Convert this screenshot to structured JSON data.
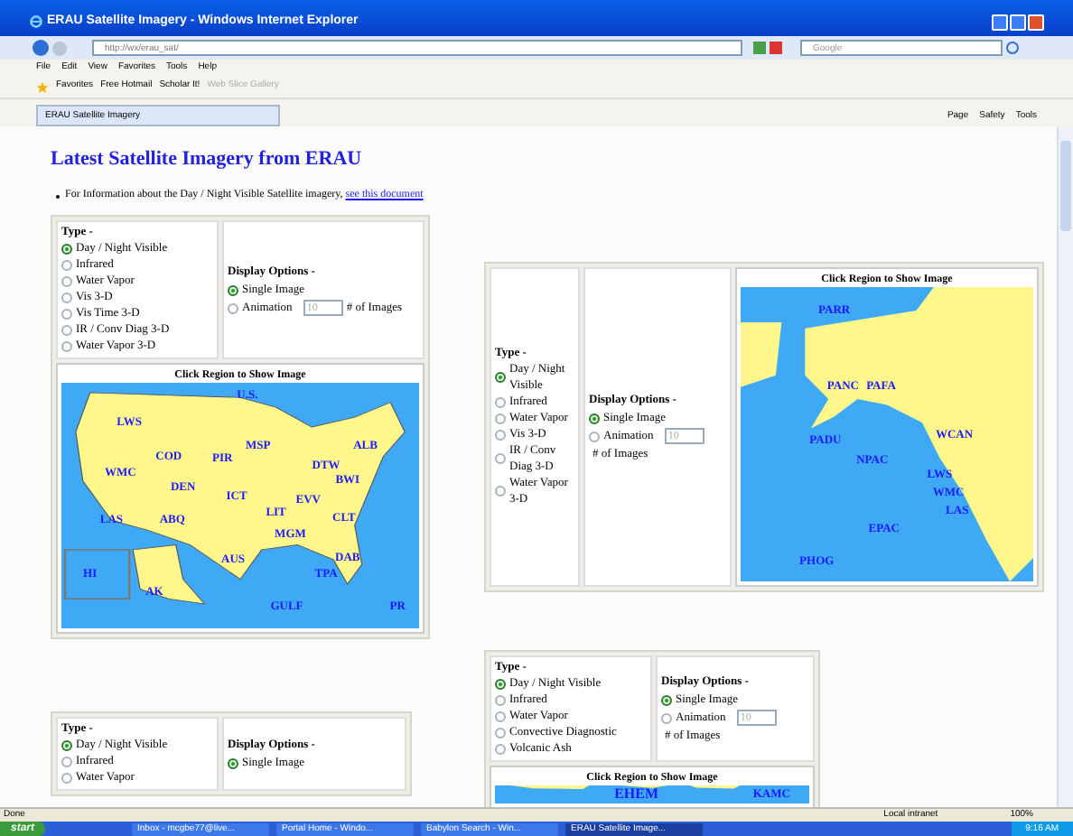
{
  "window": {
    "title": "ERAU Satellite Imagery - Windows Internet Explorer"
  },
  "address_bar": {
    "url": "http://wx/erau_sat/",
    "search_placeholder": "Google"
  },
  "menu": [
    "File",
    "Edit",
    "View",
    "Favorites",
    "Tools",
    "Help"
  ],
  "favorites_bar": {
    "label": "Favorites",
    "links": [
      {
        "label": "Free Hotmail",
        "disabled": false
      },
      {
        "label": "Scholar It!",
        "disabled": false
      },
      {
        "label": "Web Slice Gallery",
        "disabled": true
      }
    ]
  },
  "tabs": [
    {
      "label": "ERAU Satellite Imagery",
      "selected": true
    }
  ],
  "command_bar": [
    "Page",
    "Safety",
    "Tools"
  ],
  "page": {
    "heading": "Latest Satellite Imagery from ERAU",
    "info": {
      "text": "For Information about the Day / Night Visible Satellite imagery,",
      "link": "see this document"
    },
    "panels": [
      {
        "type_label": "Type -",
        "types": [
          {
            "label": "Day / Night Visible",
            "selected": true
          },
          {
            "label": "Infrared",
            "selected": false
          },
          {
            "label": "Water Vapor",
            "selected": false
          },
          {
            "label": "Vis 3-D",
            "selected": false
          },
          {
            "label": "Vis Time 3-D",
            "selected": false
          },
          {
            "label": "IR / Conv Diag 3-D",
            "selected": false
          },
          {
            "label": "Water Vapor 3-D",
            "selected": false
          }
        ],
        "display_label": "Display Options -",
        "display": [
          {
            "label": "Single Image",
            "selected": true
          },
          {
            "label": "Animation",
            "selected": false
          }
        ],
        "frames": {
          "value": "10",
          "label": "# of Images"
        },
        "map": {
          "caption": "Click Region to Show Image",
          "kind": "conus",
          "labels": [
            "U.S.",
            "LWS",
            "COD",
            "PIR",
            "MSP",
            "ALB",
            "DTW",
            "WMC",
            "DEN",
            "ICT",
            "BWI",
            "EVV",
            "LAS",
            "ABQ",
            "LIT",
            "CLT",
            "MGM",
            "AUS",
            "DAB",
            "TPA",
            "HI",
            "AK",
            "GULF",
            "PR"
          ]
        }
      },
      {
        "type_label": "Type -",
        "types": [
          {
            "label": "Day / Night Visible",
            "selected": true
          },
          {
            "label": "Infrared",
            "selected": false
          },
          {
            "label": "Water Vapor",
            "selected": false
          },
          {
            "label": "Vis 3-D",
            "selected": false
          },
          {
            "label": "IR / Conv Diag 3-D",
            "selected": false
          },
          {
            "label": "Water Vapor 3-D",
            "selected": false
          }
        ],
        "display_label": "Display Options -",
        "display": [
          {
            "label": "Single Image",
            "selected": true
          },
          {
            "label": "Animation",
            "selected": false
          }
        ],
        "frames": {
          "value": "10",
          "label": "# of Images"
        },
        "map": {
          "caption": "Click Region to Show Image",
          "kind": "pacific",
          "labels": [
            "PARR",
            "PANC",
            "PAFA",
            "PADU",
            "WCAN",
            "NPAC",
            "LWS",
            "WMC",
            "LAS",
            "EPAC",
            "PHOG"
          ]
        }
      },
      {
        "type_label": "Type -",
        "types": [
          {
            "label": "Day / Night Visible",
            "selected": true
          },
          {
            "label": "Infrared",
            "selected": false
          },
          {
            "label": "Water Vapor",
            "selected": false
          },
          {
            "label": "Convective Diagnostic",
            "selected": false
          },
          {
            "label": "Volcanic Ash",
            "selected": false
          }
        ],
        "display_label": "Display Options -",
        "display": [
          {
            "label": "Single Image",
            "selected": true
          },
          {
            "label": "Animation",
            "selected": false
          }
        ],
        "frames": {
          "value": "10",
          "label": "# of Images"
        },
        "map": {
          "caption": "Click Region to Show Image",
          "kind": "hemisphere",
          "labels": [
            "EHEM",
            "KAMC"
          ]
        }
      },
      {
        "type_label": "Type -",
        "types": [
          {
            "label": "Day / Night Visible",
            "selected": true
          },
          {
            "label": "Infrared",
            "selected": false
          },
          {
            "label": "Water Vapor",
            "selected": false
          }
        ],
        "display_label": "Display Options -",
        "display": [
          {
            "label": "Single Image",
            "selected": true
          }
        ]
      }
    ]
  },
  "status_bar": {
    "status": "Done",
    "zone": "Local intranet",
    "zoom": "100%"
  },
  "taskbar": {
    "start": "start",
    "items": [
      {
        "label": "Inbox - mcgbe77@live...",
        "selected": false
      },
      {
        "label": "Portal Home - Windo...",
        "selected": false
      },
      {
        "label": "Babylon Search - Win...",
        "selected": false
      },
      {
        "label": "ERAU Satellite Image...",
        "selected": true
      }
    ],
    "time": "9:16 AM"
  }
}
